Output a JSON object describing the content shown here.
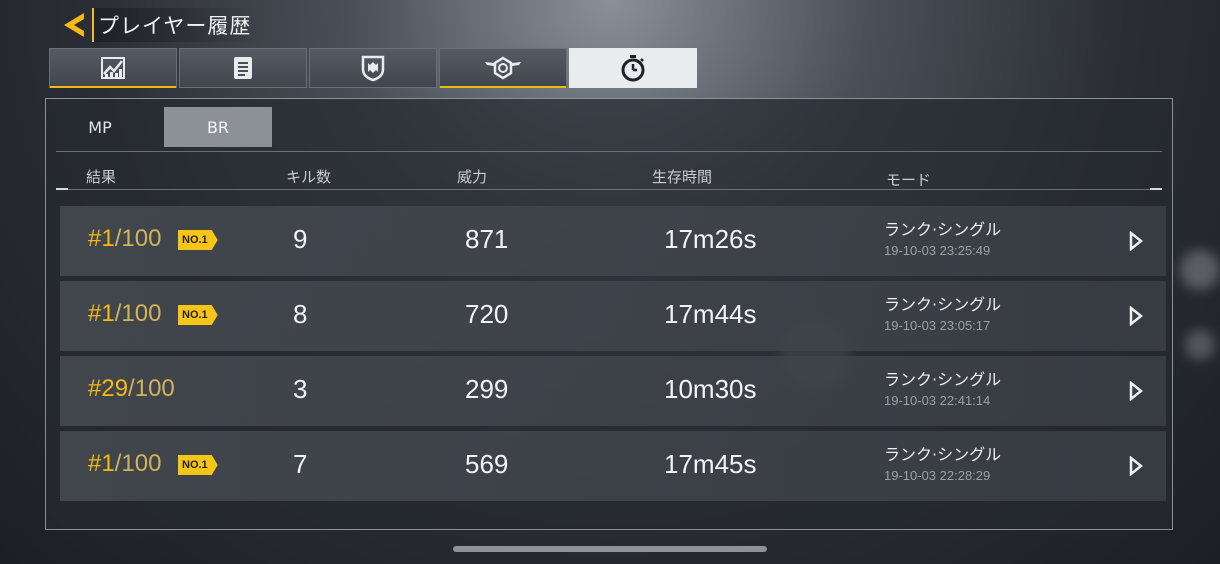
{
  "header": {
    "title": "プレイヤー履歴"
  },
  "tabs": [
    {
      "icon": "stats-chart-icon"
    },
    {
      "icon": "clipboard-icon"
    },
    {
      "icon": "shield-icon"
    },
    {
      "icon": "winged-emblem-icon"
    },
    {
      "icon": "stopwatch-icon"
    }
  ],
  "subtabs": {
    "mp": "MP",
    "br": "BR"
  },
  "columns": {
    "result": "結果",
    "kills": "キル数",
    "power": "威力",
    "survival": "生存時間",
    "mode": "モード"
  },
  "matches": [
    {
      "rank": "#1",
      "total": "/100",
      "badge": "NO.1",
      "kills": "9",
      "power": "871",
      "survival": "17m26s",
      "mode": "ランク·シングル",
      "timestamp": "19-10-03 23:25:49"
    },
    {
      "rank": "#1",
      "total": "/100",
      "badge": "NO.1",
      "kills": "8",
      "power": "720",
      "survival": "17m44s",
      "mode": "ランク·シングル",
      "timestamp": "19-10-03 23:05:17"
    },
    {
      "rank": "#29",
      "total": "/100",
      "badge": "",
      "kills": "3",
      "power": "299",
      "survival": "10m30s",
      "mode": "ランク·シングル",
      "timestamp": "19-10-03 22:41:14"
    },
    {
      "rank": "#1",
      "total": "/100",
      "badge": "NO.1",
      "kills": "7",
      "power": "569",
      "survival": "17m45s",
      "mode": "ランク·シングル",
      "timestamp": "19-10-03 22:28:29"
    }
  ],
  "colors": {
    "accent": "#f5b814",
    "rank_total": "#d0b35a",
    "panel_border": "#8a9098"
  }
}
